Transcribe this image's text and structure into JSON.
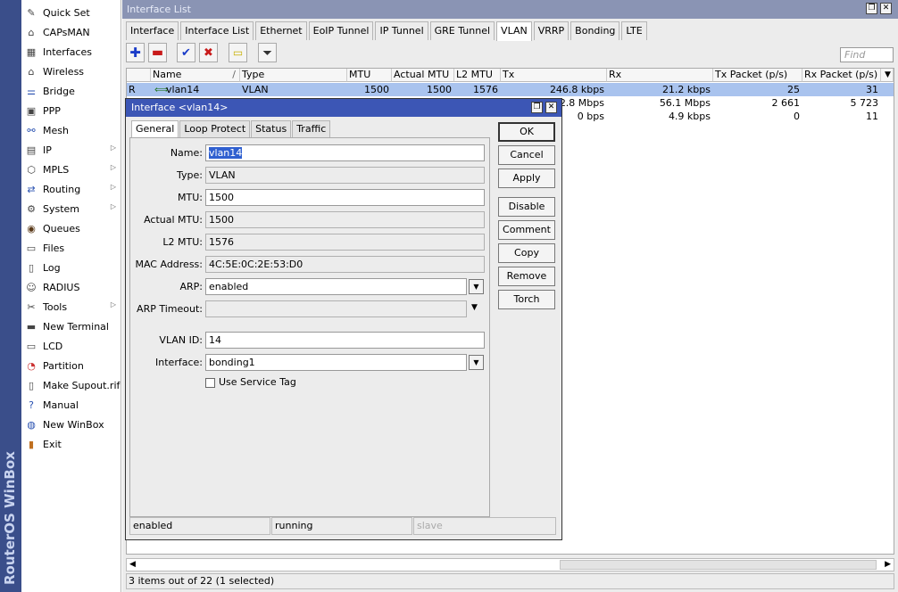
{
  "brand": "RouterOS WinBox",
  "sidebar": {
    "items": [
      {
        "label": "Quick Set",
        "icon": "quick-set-icon",
        "arrow": false
      },
      {
        "label": "CAPsMAN",
        "icon": "capsman-icon",
        "arrow": false
      },
      {
        "label": "Interfaces",
        "icon": "interfaces-icon",
        "arrow": false
      },
      {
        "label": "Wireless",
        "icon": "wireless-icon",
        "arrow": false
      },
      {
        "label": "Bridge",
        "icon": "bridge-icon",
        "arrow": false
      },
      {
        "label": "PPP",
        "icon": "ppp-icon",
        "arrow": false
      },
      {
        "label": "Mesh",
        "icon": "mesh-icon",
        "arrow": false
      },
      {
        "label": "IP",
        "icon": "ip-icon",
        "arrow": true
      },
      {
        "label": "MPLS",
        "icon": "mpls-icon",
        "arrow": true
      },
      {
        "label": "Routing",
        "icon": "routing-icon",
        "arrow": true
      },
      {
        "label": "System",
        "icon": "system-icon",
        "arrow": true
      },
      {
        "label": "Queues",
        "icon": "queues-icon",
        "arrow": false
      },
      {
        "label": "Files",
        "icon": "files-icon",
        "arrow": false
      },
      {
        "label": "Log",
        "icon": "log-icon",
        "arrow": false
      },
      {
        "label": "RADIUS",
        "icon": "radius-icon",
        "arrow": false
      },
      {
        "label": "Tools",
        "icon": "tools-icon",
        "arrow": true
      },
      {
        "label": "New Terminal",
        "icon": "terminal-icon",
        "arrow": false
      },
      {
        "label": "LCD",
        "icon": "lcd-icon",
        "arrow": false
      },
      {
        "label": "Partition",
        "icon": "partition-icon",
        "arrow": false
      },
      {
        "label": "Make Supout.rif",
        "icon": "supout-icon",
        "arrow": false
      },
      {
        "label": "Manual",
        "icon": "manual-icon",
        "arrow": false
      },
      {
        "label": "New WinBox",
        "icon": "winbox-icon",
        "arrow": false
      },
      {
        "label": "Exit",
        "icon": "exit-icon",
        "arrow": false
      }
    ]
  },
  "window": {
    "title": "Interface List"
  },
  "tabs": [
    "Interface",
    "Interface List",
    "Ethernet",
    "EoIP Tunnel",
    "IP Tunnel",
    "GRE Tunnel",
    "VLAN",
    "VRRP",
    "Bonding",
    "LTE"
  ],
  "active_tab": "VLAN",
  "find_placeholder": "Find",
  "table": {
    "columns": [
      "",
      "Name",
      "Type",
      "MTU",
      "Actual MTU",
      "L2 MTU",
      "Tx",
      "Rx",
      "Tx Packet (p/s)",
      "Rx Packet (p/s)"
    ],
    "rows": [
      {
        "flag": "R",
        "name": "vlan14",
        "type": "VLAN",
        "mtu": "1500",
        "actual_mtu": "1500",
        "l2_mtu": "1576",
        "tx": "246.8 kbps",
        "rx": "21.2 kbps",
        "tx_pps": "25",
        "rx_pps": "31",
        "selected": true
      },
      {
        "flag": "",
        "name": "",
        "type": "",
        "mtu": "",
        "actual_mtu": "",
        "l2_mtu": "",
        "tx": "2.8 Mbps",
        "rx": "56.1 Mbps",
        "tx_pps": "2 661",
        "rx_pps": "5 723",
        "selected": false
      },
      {
        "flag": "",
        "name": "",
        "type": "",
        "mtu": "",
        "actual_mtu": "",
        "l2_mtu": "",
        "tx": "0 bps",
        "rx": "4.9 kbps",
        "tx_pps": "0",
        "rx_pps": "11",
        "selected": false
      }
    ]
  },
  "status_bar": "3 items out of 22 (1 selected)",
  "dialog": {
    "title": "Interface <vlan14>",
    "tabs": [
      "General",
      "Loop Protect",
      "Status",
      "Traffic"
    ],
    "active_tab": "General",
    "fields": {
      "name_label": "Name:",
      "name": "vlan14",
      "type_label": "Type:",
      "type": "VLAN",
      "mtu_label": "MTU:",
      "mtu": "1500",
      "actual_mtu_label": "Actual MTU:",
      "actual_mtu": "1500",
      "l2_mtu_label": "L2 MTU:",
      "l2_mtu": "1576",
      "mac_label": "MAC Address:",
      "mac": "4C:5E:0C:2E:53:D0",
      "arp_label": "ARP:",
      "arp": "enabled",
      "arp_timeout_label": "ARP Timeout:",
      "arp_timeout": "",
      "vlan_id_label": "VLAN ID:",
      "vlan_id": "14",
      "interface_label": "Interface:",
      "interface": "bonding1",
      "service_tag_label": "Use Service Tag"
    },
    "buttons": [
      "OK",
      "Cancel",
      "Apply",
      "Disable",
      "Comment",
      "Copy",
      "Remove",
      "Torch"
    ],
    "status": [
      "enabled",
      "running",
      "slave"
    ]
  }
}
